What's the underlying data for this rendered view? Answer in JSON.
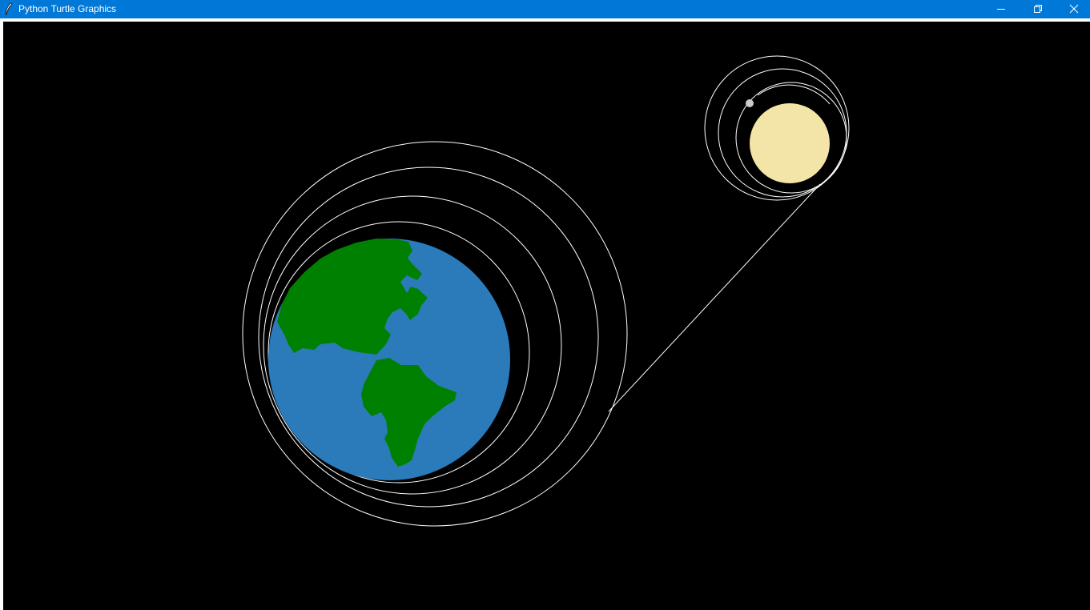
{
  "window": {
    "title": "Python Turtle Graphics",
    "icons": {
      "app": "feather-icon",
      "minimize": "minimize-icon",
      "restore": "restore-icon",
      "close": "close-icon"
    }
  },
  "canvas": {
    "background": "#000000",
    "trail_color": "#ffffff",
    "earth": {
      "ocean_color": "#2b7bba",
      "land_color": "#008000"
    },
    "moon": {
      "color": "#f3e5a7"
    },
    "satellite": {
      "color": "#c8cdc8"
    }
  }
}
